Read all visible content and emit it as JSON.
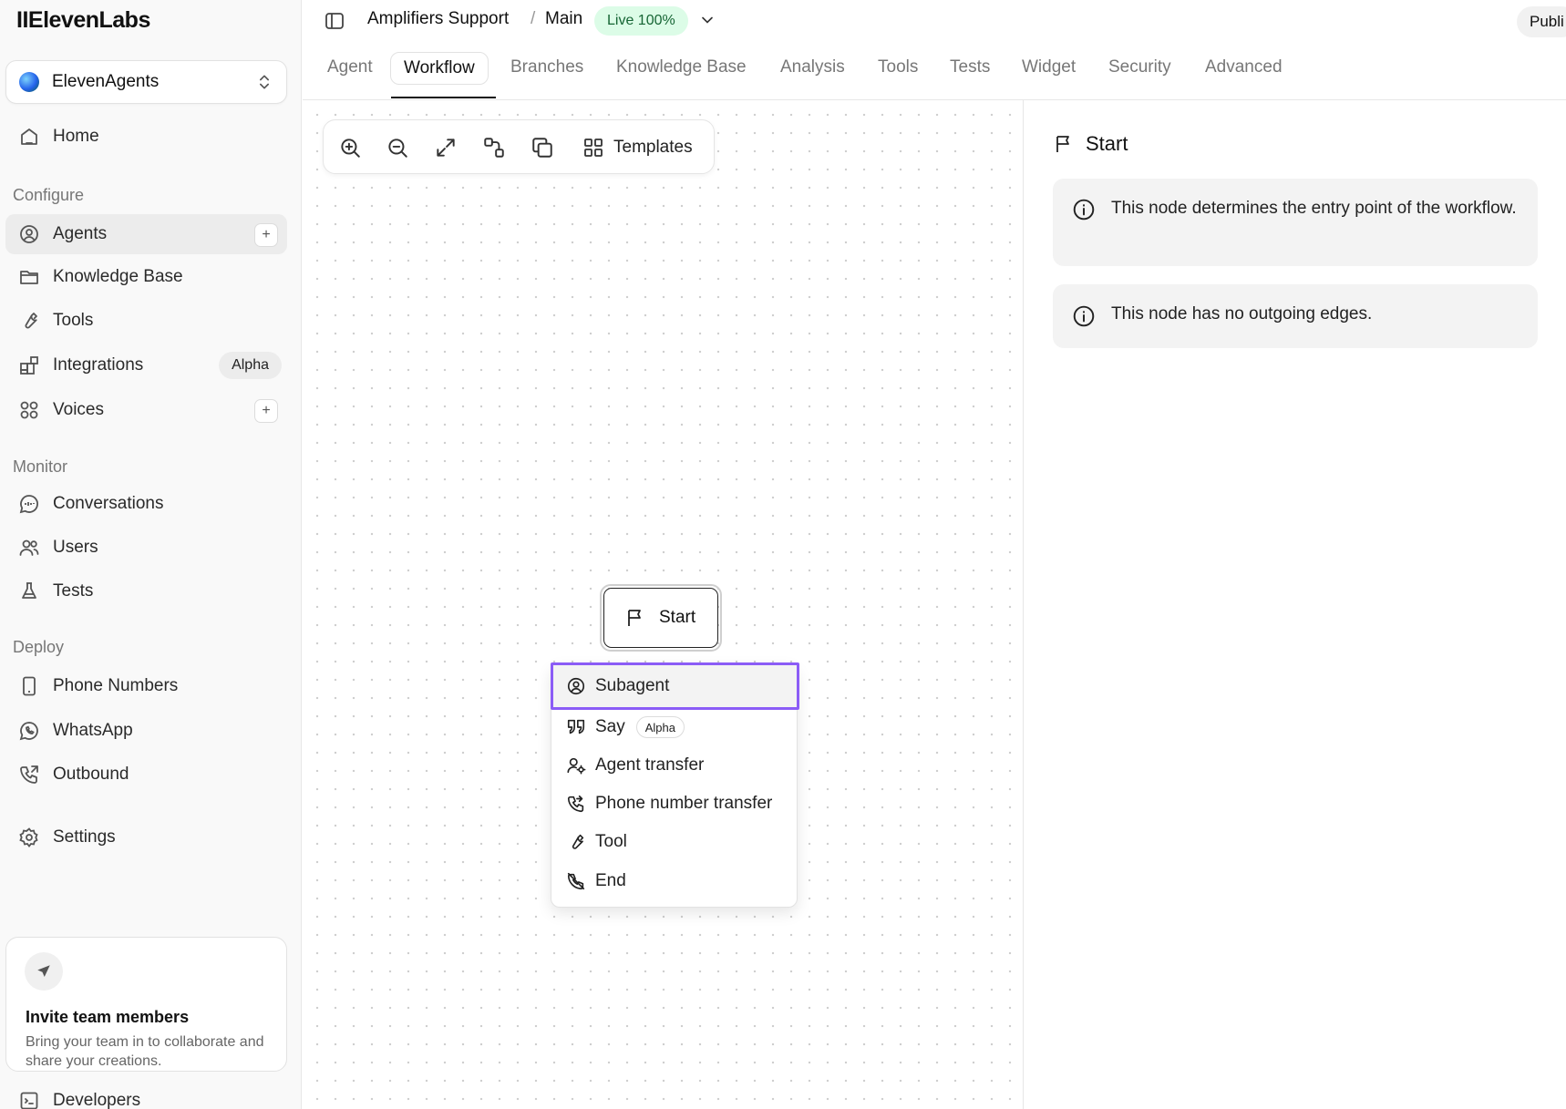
{
  "app": {
    "logo": "IIElevenLabs"
  },
  "workspace": {
    "name": "ElevenAgents"
  },
  "sidebar": {
    "home": "Home",
    "sections": {
      "configure": "Configure",
      "monitor": "Monitor",
      "deploy": "Deploy"
    },
    "configure": [
      {
        "label": "Agents",
        "icon": "agent-icon",
        "active": true,
        "plus": "+"
      },
      {
        "label": "Knowledge Base",
        "icon": "folder-icon"
      },
      {
        "label": "Tools",
        "icon": "wrench-icon"
      },
      {
        "label": "Integrations",
        "icon": "integrations-icon",
        "badge": "Alpha"
      },
      {
        "label": "Voices",
        "icon": "voices-icon",
        "plus": "+"
      }
    ],
    "monitor": [
      {
        "label": "Conversations",
        "icon": "chat-icon"
      },
      {
        "label": "Users",
        "icon": "users-icon"
      },
      {
        "label": "Tests",
        "icon": "flask-icon"
      }
    ],
    "deploy": [
      {
        "label": "Phone Numbers",
        "icon": "phone-device-icon"
      },
      {
        "label": "WhatsApp",
        "icon": "whatsapp-icon"
      },
      {
        "label": "Outbound",
        "icon": "outbound-call-icon"
      }
    ],
    "settings": "Settings",
    "developers": "Developers",
    "invite": {
      "title": "Invite team members",
      "description": "Bring your team in to collaborate and share your creations."
    }
  },
  "header": {
    "breadcrumb": [
      "Amplifiers Support",
      "/",
      "Main"
    ],
    "live_badge": "Live 100%",
    "publish": "Publi"
  },
  "tabs": [
    "Agent",
    "Workflow",
    "Branches",
    "Knowledge Base",
    "Analysis",
    "Tools",
    "Tests",
    "Widget",
    "Security",
    "Advanced"
  ],
  "active_tab": "Workflow",
  "toolbar": {
    "templates": "Templates"
  },
  "canvas": {
    "start_node": "Start",
    "menu": [
      {
        "label": "Subagent",
        "icon": "subagent-icon",
        "highlighted": true
      },
      {
        "label": "Say",
        "icon": "quote-icon",
        "badge": "Alpha"
      },
      {
        "label": "Agent transfer",
        "icon": "agent-transfer-icon"
      },
      {
        "label": "Phone number transfer",
        "icon": "phone-transfer-icon"
      },
      {
        "label": "Tool",
        "icon": "wrench-icon"
      },
      {
        "label": "End",
        "icon": "end-call-icon"
      }
    ]
  },
  "panel": {
    "title": "Start",
    "info": [
      "This node determines the entry point of the workflow.",
      "This node has no outgoing edges."
    ]
  },
  "colors": {
    "highlight": "#8b5cf6",
    "live_bg": "#dcfce7",
    "live_text": "#166534"
  }
}
